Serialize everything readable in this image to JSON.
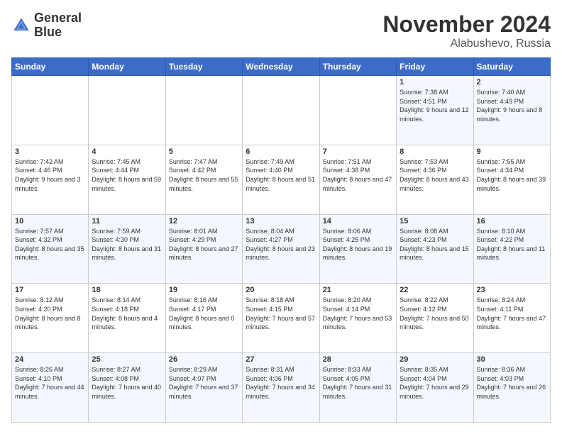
{
  "header": {
    "logo_line1": "General",
    "logo_line2": "Blue",
    "month_title": "November 2024",
    "location": "Alabushevo, Russia"
  },
  "weekdays": [
    "Sunday",
    "Monday",
    "Tuesday",
    "Wednesday",
    "Thursday",
    "Friday",
    "Saturday"
  ],
  "weeks": [
    [
      {
        "day": "",
        "sunrise": "",
        "sunset": "",
        "daylight": ""
      },
      {
        "day": "",
        "sunrise": "",
        "sunset": "",
        "daylight": ""
      },
      {
        "day": "",
        "sunrise": "",
        "sunset": "",
        "daylight": ""
      },
      {
        "day": "",
        "sunrise": "",
        "sunset": "",
        "daylight": ""
      },
      {
        "day": "",
        "sunrise": "",
        "sunset": "",
        "daylight": ""
      },
      {
        "day": "1",
        "sunrise": "Sunrise: 7:38 AM",
        "sunset": "Sunset: 4:51 PM",
        "daylight": "Daylight: 9 hours and 12 minutes."
      },
      {
        "day": "2",
        "sunrise": "Sunrise: 7:40 AM",
        "sunset": "Sunset: 4:49 PM",
        "daylight": "Daylight: 9 hours and 8 minutes."
      }
    ],
    [
      {
        "day": "3",
        "sunrise": "Sunrise: 7:42 AM",
        "sunset": "Sunset: 4:46 PM",
        "daylight": "Daylight: 9 hours and 3 minutes."
      },
      {
        "day": "4",
        "sunrise": "Sunrise: 7:45 AM",
        "sunset": "Sunset: 4:44 PM",
        "daylight": "Daylight: 8 hours and 59 minutes."
      },
      {
        "day": "5",
        "sunrise": "Sunrise: 7:47 AM",
        "sunset": "Sunset: 4:42 PM",
        "daylight": "Daylight: 8 hours and 55 minutes."
      },
      {
        "day": "6",
        "sunrise": "Sunrise: 7:49 AM",
        "sunset": "Sunset: 4:40 PM",
        "daylight": "Daylight: 8 hours and 51 minutes."
      },
      {
        "day": "7",
        "sunrise": "Sunrise: 7:51 AM",
        "sunset": "Sunset: 4:38 PM",
        "daylight": "Daylight: 8 hours and 47 minutes."
      },
      {
        "day": "8",
        "sunrise": "Sunrise: 7:53 AM",
        "sunset": "Sunset: 4:36 PM",
        "daylight": "Daylight: 8 hours and 43 minutes."
      },
      {
        "day": "9",
        "sunrise": "Sunrise: 7:55 AM",
        "sunset": "Sunset: 4:34 PM",
        "daylight": "Daylight: 8 hours and 39 minutes."
      }
    ],
    [
      {
        "day": "10",
        "sunrise": "Sunrise: 7:57 AM",
        "sunset": "Sunset: 4:32 PM",
        "daylight": "Daylight: 8 hours and 35 minutes."
      },
      {
        "day": "11",
        "sunrise": "Sunrise: 7:59 AM",
        "sunset": "Sunset: 4:30 PM",
        "daylight": "Daylight: 8 hours and 31 minutes."
      },
      {
        "day": "12",
        "sunrise": "Sunrise: 8:01 AM",
        "sunset": "Sunset: 4:29 PM",
        "daylight": "Daylight: 8 hours and 27 minutes."
      },
      {
        "day": "13",
        "sunrise": "Sunrise: 8:04 AM",
        "sunset": "Sunset: 4:27 PM",
        "daylight": "Daylight: 8 hours and 23 minutes."
      },
      {
        "day": "14",
        "sunrise": "Sunrise: 8:06 AM",
        "sunset": "Sunset: 4:25 PM",
        "daylight": "Daylight: 8 hours and 19 minutes."
      },
      {
        "day": "15",
        "sunrise": "Sunrise: 8:08 AM",
        "sunset": "Sunset: 4:23 PM",
        "daylight": "Daylight: 8 hours and 15 minutes."
      },
      {
        "day": "16",
        "sunrise": "Sunrise: 8:10 AM",
        "sunset": "Sunset: 4:22 PM",
        "daylight": "Daylight: 8 hours and 11 minutes."
      }
    ],
    [
      {
        "day": "17",
        "sunrise": "Sunrise: 8:12 AM",
        "sunset": "Sunset: 4:20 PM",
        "daylight": "Daylight: 8 hours and 8 minutes."
      },
      {
        "day": "18",
        "sunrise": "Sunrise: 8:14 AM",
        "sunset": "Sunset: 4:18 PM",
        "daylight": "Daylight: 8 hours and 4 minutes."
      },
      {
        "day": "19",
        "sunrise": "Sunrise: 8:16 AM",
        "sunset": "Sunset: 4:17 PM",
        "daylight": "Daylight: 8 hours and 0 minutes."
      },
      {
        "day": "20",
        "sunrise": "Sunrise: 8:18 AM",
        "sunset": "Sunset: 4:15 PM",
        "daylight": "Daylight: 7 hours and 57 minutes."
      },
      {
        "day": "21",
        "sunrise": "Sunrise: 8:20 AM",
        "sunset": "Sunset: 4:14 PM",
        "daylight": "Daylight: 7 hours and 53 minutes."
      },
      {
        "day": "22",
        "sunrise": "Sunrise: 8:22 AM",
        "sunset": "Sunset: 4:12 PM",
        "daylight": "Daylight: 7 hours and 50 minutes."
      },
      {
        "day": "23",
        "sunrise": "Sunrise: 8:24 AM",
        "sunset": "Sunset: 4:11 PM",
        "daylight": "Daylight: 7 hours and 47 minutes."
      }
    ],
    [
      {
        "day": "24",
        "sunrise": "Sunrise: 8:26 AM",
        "sunset": "Sunset: 4:10 PM",
        "daylight": "Daylight: 7 hours and 44 minutes."
      },
      {
        "day": "25",
        "sunrise": "Sunrise: 8:27 AM",
        "sunset": "Sunset: 4:08 PM",
        "daylight": "Daylight: 7 hours and 40 minutes."
      },
      {
        "day": "26",
        "sunrise": "Sunrise: 8:29 AM",
        "sunset": "Sunset: 4:07 PM",
        "daylight": "Daylight: 7 hours and 37 minutes."
      },
      {
        "day": "27",
        "sunrise": "Sunrise: 8:31 AM",
        "sunset": "Sunset: 4:06 PM",
        "daylight": "Daylight: 7 hours and 34 minutes."
      },
      {
        "day": "28",
        "sunrise": "Sunrise: 8:33 AM",
        "sunset": "Sunset: 4:05 PM",
        "daylight": "Daylight: 7 hours and 31 minutes."
      },
      {
        "day": "29",
        "sunrise": "Sunrise: 8:35 AM",
        "sunset": "Sunset: 4:04 PM",
        "daylight": "Daylight: 7 hours and 29 minutes."
      },
      {
        "day": "30",
        "sunrise": "Sunrise: 8:36 AM",
        "sunset": "Sunset: 4:03 PM",
        "daylight": "Daylight: 7 hours and 26 minutes."
      }
    ]
  ]
}
